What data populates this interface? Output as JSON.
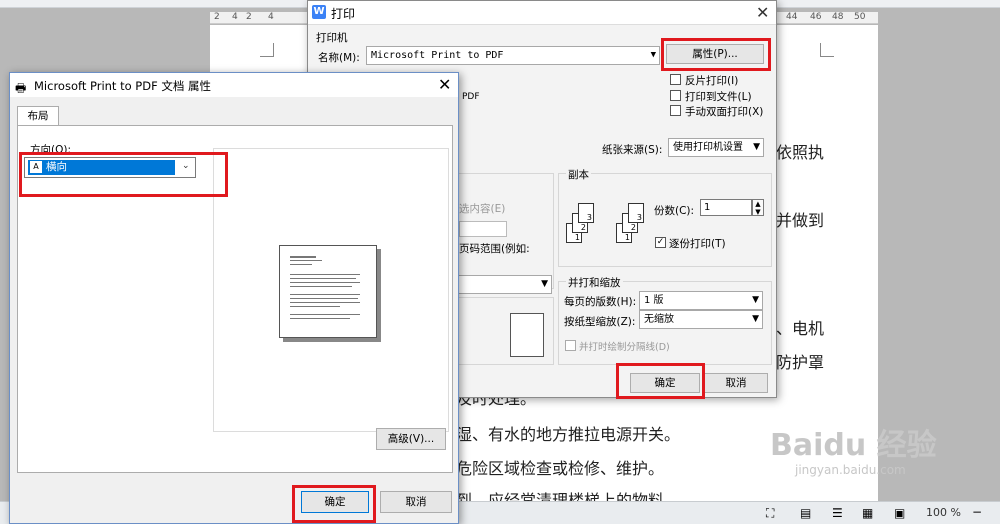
{
  "background": {
    "ruler_left": [
      "4",
      "2",
      "2",
      "4"
    ],
    "ruler_right": [
      "44",
      "46",
      "48",
      "50"
    ],
    "doc_lines": [
      {
        "text": "依照执"
      },
      {
        "text": "并做到"
      },
      {
        "text": "、电机"
      },
      {
        "text": "防护罩"
      },
      {
        "text": "及时处理。"
      },
      {
        "text": "湿、有水的地方推拉电源开关。"
      },
      {
        "text": "危险区域检查或检修、维护。"
      },
      {
        "text": "到，应经常清理楼梯上的物料"
      }
    ],
    "zoom": "100 %",
    "watermark": "Baidu 经验",
    "watermark_sub": "jingyan.baidu.com"
  },
  "print_dialog": {
    "icon_letter": "W",
    "title": "打印",
    "close": "✕",
    "printer_group": "打印机",
    "name_label": "名称(M):",
    "printer_name": "Microsoft Print to PDF",
    "properties_button": "属性(P)...",
    "reverse_print": "反片打印(I)",
    "print_to_file": "打印到文件(L)",
    "manual_duplex": "手动双面打印(X)",
    "type_partial": "PDF",
    "paper_source_label": "纸张来源(S):",
    "paper_source_value": "使用打印机设置",
    "range_partial_1": "选内容(E)",
    "range_partial_2": "页码范围(例如:",
    "copies_group": "副本",
    "copies_label": "份数(C):",
    "copies_value": "1",
    "collate": "逐份打印(T)",
    "pages_per_sheet_group": "并打和缩放",
    "pages_per_sheet_label": "每页的版数(H):",
    "pages_per_sheet_value": "1 版",
    "scale_label": "按纸型缩放(Z):",
    "scale_value": "无缩放",
    "draw_border": "并打时绘制分隔线(D)",
    "ok": "确定",
    "cancel": "取消"
  },
  "props_dialog": {
    "title": "Microsoft Print to PDF 文档 属性",
    "close": "✕",
    "tab": "布局",
    "orientation_label": "方向(O):",
    "orientation_value": "横向",
    "advanced_button": "高级(V)...",
    "ok": "确定",
    "cancel": "取消"
  },
  "colors": {
    "highlight": "#e0191e",
    "accent": "#0078d7"
  }
}
